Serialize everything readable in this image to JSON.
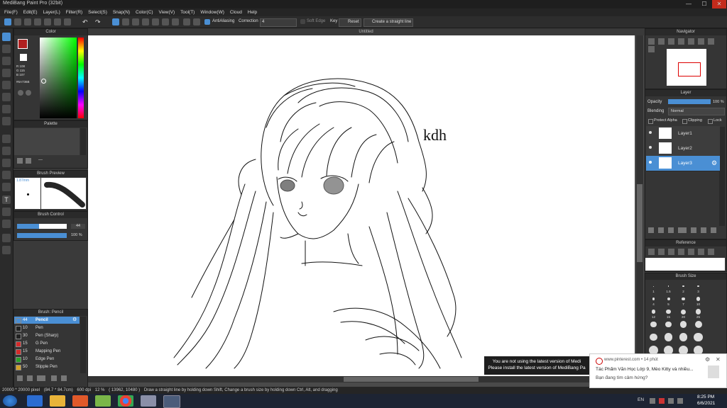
{
  "window": {
    "title": "MediBang Paint Pro (32bit)",
    "min": "—",
    "max": "☐",
    "close": "✕"
  },
  "menu": [
    "File(F)",
    "Edit(E)",
    "Layer(L)",
    "Filter(R)",
    "Select(S)",
    "Snap(N)",
    "Color(C)",
    "View(V)",
    "Tool(T)",
    "Window(W)",
    "Cloud",
    "Help"
  ],
  "toolbar": {
    "antialiasing": "AntiAliasing",
    "correction_label": "Correction",
    "correction_value": "4",
    "soft_edge": "Soft Edge",
    "key": "Key",
    "reset": "Reset",
    "straight_line": "Create a straight line"
  },
  "canvas": {
    "title": "Untitled",
    "signature": "kdh"
  },
  "color_panel": {
    "title": "Color",
    "r": "R 108",
    "g": "G 115",
    "b": "B 107",
    "hex": "#6A736B",
    "accent": "#4a8fd4"
  },
  "palette": {
    "title": "Palette",
    "dash": "---"
  },
  "brush_preview": {
    "title": "Brush Preview",
    "size": "1.87mm"
  },
  "brush_control": {
    "title": "Brush Control",
    "size_value": "44",
    "opacity_value": "100 %",
    "size_fraction": 0.44,
    "opacity_fraction": 1.0
  },
  "brush_list": {
    "title": "Brush: Pencil",
    "items": [
      {
        "size": "44",
        "name": "Pencil",
        "color": "#4a8fd4",
        "selected": true
      },
      {
        "size": "10",
        "name": "Pen",
        "color": "#222222",
        "selected": false
      },
      {
        "size": "30",
        "name": "Pen (Sharp)",
        "color": "#222222",
        "selected": false
      },
      {
        "size": "15",
        "name": "G Pen",
        "color": "#d42a2a",
        "selected": false
      },
      {
        "size": "15",
        "name": "Mapping Pen",
        "color": "#d42a2a",
        "selected": false
      },
      {
        "size": "10",
        "name": "Edge Pen",
        "color": "#2aa02a",
        "selected": false
      },
      {
        "size": "50",
        "name": "Stipple Pen",
        "color": "#d4a22a",
        "selected": false
      }
    ]
  },
  "navigator": {
    "title": "Navigator"
  },
  "layer_panel": {
    "title": "Layer",
    "opacity_label": "Opacity",
    "opacity_value": "100 %",
    "blending_label": "Blending",
    "blending_value": "Normal",
    "protect_alpha": "Protect Alpha",
    "clipping": "Clipping",
    "lock": "Lock",
    "layers": [
      {
        "name": "Layer1",
        "selected": false
      },
      {
        "name": "Layer2",
        "selected": false
      },
      {
        "name": "Layer3",
        "selected": true
      }
    ]
  },
  "reference": {
    "title": "Reference"
  },
  "brush_size": {
    "title": "Brush Size",
    "labels": [
      "1",
      "1.5",
      "2",
      "3",
      "4",
      "5",
      "7",
      "10",
      "12",
      "15",
      "20",
      "25"
    ]
  },
  "status": {
    "dimensions": "20000 * 20000 pixel",
    "size": "(84.7 * 84.7cm)",
    "dpi": "600 dpi",
    "zoom": "12 %",
    "coords": "( 13962, 10480 )",
    "hint": "Draw a straight line by holding down Shift, Change a brush size by holding down Ctrl, Alt, and dragging"
  },
  "notification_update": {
    "line1": "You are not using the latest version of Medi",
    "line2": "Please install the latest version of MediBang Pa"
  },
  "notification_pinterest": {
    "source": "www.pinterest.com • 14 phút",
    "title": "Tác Phẩm Văn Học Lớp 9, Mèo Kitty và nhiều...",
    "subtitle": "Bạn đang tìm cảm hứng?"
  },
  "taskbar": {
    "lang": "EN",
    "time": "8:25 PM",
    "date": "6/6/2021"
  }
}
